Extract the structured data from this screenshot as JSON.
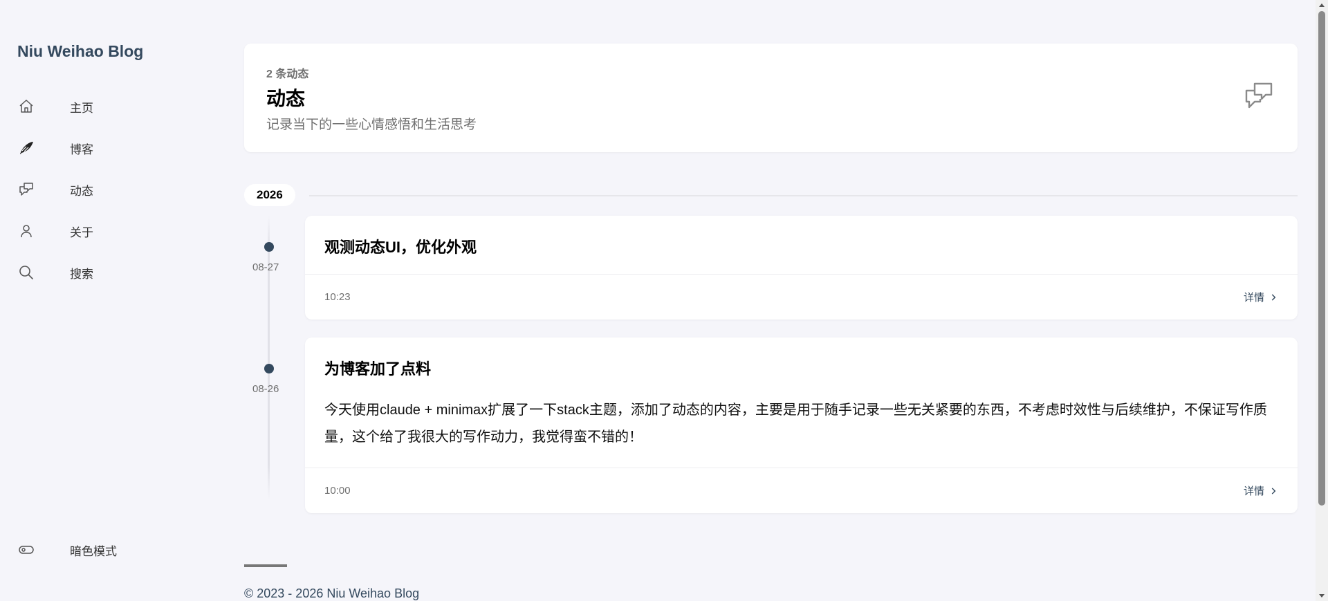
{
  "site": {
    "title": "Niu Weihao Blog"
  },
  "nav": {
    "items": [
      {
        "label": "主页",
        "icon": "home-icon"
      },
      {
        "label": "博客",
        "icon": "quill-icon"
      },
      {
        "label": "动态",
        "icon": "chat-icon"
      },
      {
        "label": "关于",
        "icon": "user-icon"
      },
      {
        "label": "搜索",
        "icon": "search-icon"
      }
    ],
    "dark_mode": {
      "label": "暗色模式",
      "icon": "toggle-icon"
    }
  },
  "header": {
    "count": "2 条动态",
    "title": "动态",
    "description": "记录当下的一些心情感悟和生活思考",
    "icon": "chat-icon"
  },
  "year": "2026",
  "entries": [
    {
      "date": "08-27",
      "title": "观测动态UI，优化外观",
      "body": "",
      "time": "10:23",
      "detail": "详情"
    },
    {
      "date": "08-26",
      "title": "为博客加了点料",
      "body": "今天使用claude + minimax扩展了一下stack主题，添加了动态的内容，主要是用于随手记录一些无关紧要的东西，不考虑时效性与后续维护，不保证写作质量，这个给了我很大的写作动力，我觉得蛮不错的！",
      "time": "10:00",
      "detail": "详情"
    }
  ],
  "footer": {
    "copyright": "© 2023 - 2026 Niu Weihao Blog"
  },
  "colors": {
    "accent": "#34495e",
    "background": "#f5f5fa",
    "card": "#ffffff",
    "muted": "#707070"
  }
}
